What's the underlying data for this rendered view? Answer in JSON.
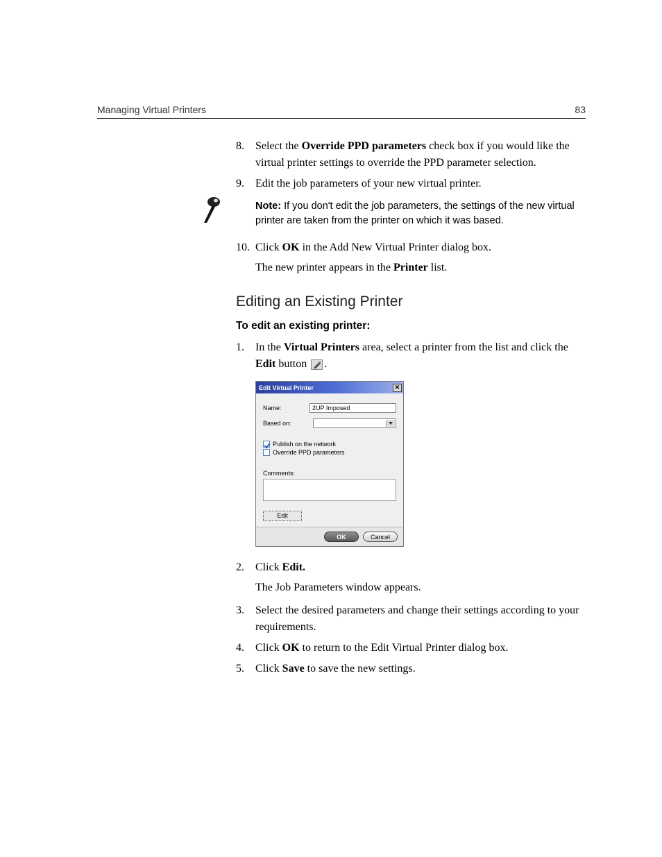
{
  "header": {
    "chapter": "Managing Virtual Printers",
    "page_number": "83"
  },
  "steps_a": {
    "s8": {
      "num": "8.",
      "pre": "Select the ",
      "bold": "Override PPD parameters",
      "post": " check box if you would like the virtual printer settings to override the PPD parameter selection."
    },
    "s9": {
      "num": "9.",
      "text": "Edit the job parameters of your new virtual printer."
    },
    "note": {
      "label": "Note:",
      "text": "  If you don't edit the job parameters, the settings of the new virtual printer are taken from the printer on which it was based."
    },
    "s10": {
      "num": "10.",
      "pre": "Click ",
      "bold": "OK",
      "post": " in the Add New Virtual Printer dialog box."
    },
    "s10_result_pre": "The new printer appears in the ",
    "s10_result_bold": "Printer",
    "s10_result_post": " list."
  },
  "section_heading": "Editing an Existing Printer",
  "lead": "To edit an existing printer:",
  "steps_b": {
    "s1": {
      "num": "1.",
      "pre": "In the ",
      "bold1": "Virtual Printers",
      "mid": " area, select a printer from the list and click the ",
      "bold2": "Edit",
      "post": " button ",
      "tail": "."
    },
    "s2": {
      "num": "2.",
      "pre": "Click ",
      "bold": "Edit."
    },
    "s2_result": "The Job Parameters window appears.",
    "s3": {
      "num": "3.",
      "text": "Select the desired parameters and change their settings according to your requirements."
    },
    "s4": {
      "num": "4.",
      "pre": "Click ",
      "bold": "OK",
      "post": " to return to the Edit Virtual Printer dialog box."
    },
    "s5": {
      "num": "5.",
      "pre": "Click ",
      "bold": "Save",
      "post": " to save the new settings."
    }
  },
  "dialog": {
    "title": "Edit Virtual Printer",
    "name_label": "Name:",
    "name_value": "2UP Imposed",
    "based_label": "Based on:",
    "publish_label": "Publish on the network",
    "override_label": "Override PPD parameters",
    "comments_label": "Comments:",
    "edit_button": "Edit",
    "ok": "OK",
    "cancel": "Cancel"
  }
}
